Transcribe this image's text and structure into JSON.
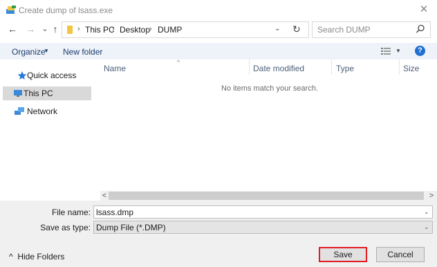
{
  "window": {
    "title": "Create dump of lsass.exe",
    "close_icon": "close-icon"
  },
  "nav": {
    "back_icon": "←",
    "forward_icon": "→",
    "recent_icon": "⌄",
    "up_icon": "↑",
    "breadcrumb": [
      "This PC",
      "Desktop",
      "DUMP"
    ],
    "breadcrumb_sep": "›",
    "dropdown_icon": "⌄",
    "refresh_icon": "↻",
    "search_placeholder": "Search DUMP"
  },
  "toolbar": {
    "organize": "Organize",
    "new_folder": "New folder",
    "help": "?"
  },
  "sidebar": {
    "items": [
      {
        "label": "Quick access",
        "icon": "star-icon",
        "selected": false
      },
      {
        "label": "This PC",
        "icon": "computer-icon",
        "selected": true
      },
      {
        "label": "Network",
        "icon": "network-icon",
        "selected": false
      }
    ]
  },
  "filelist": {
    "columns": [
      "Name",
      "Date modified",
      "Type",
      "Size"
    ],
    "empty_message": "No items match your search."
  },
  "form": {
    "file_name_label": "File name:",
    "file_name_value": "lsass.dmp",
    "save_type_label": "Save as type:",
    "save_type_value": "Dump File (*.DMP)"
  },
  "footer": {
    "hide_folders": "Hide Folders",
    "save": "Save",
    "cancel": "Cancel"
  },
  "colors": {
    "accent": "#1f6fd1",
    "highlight": "#e31b23",
    "selected_bg": "#d9d9d9"
  }
}
